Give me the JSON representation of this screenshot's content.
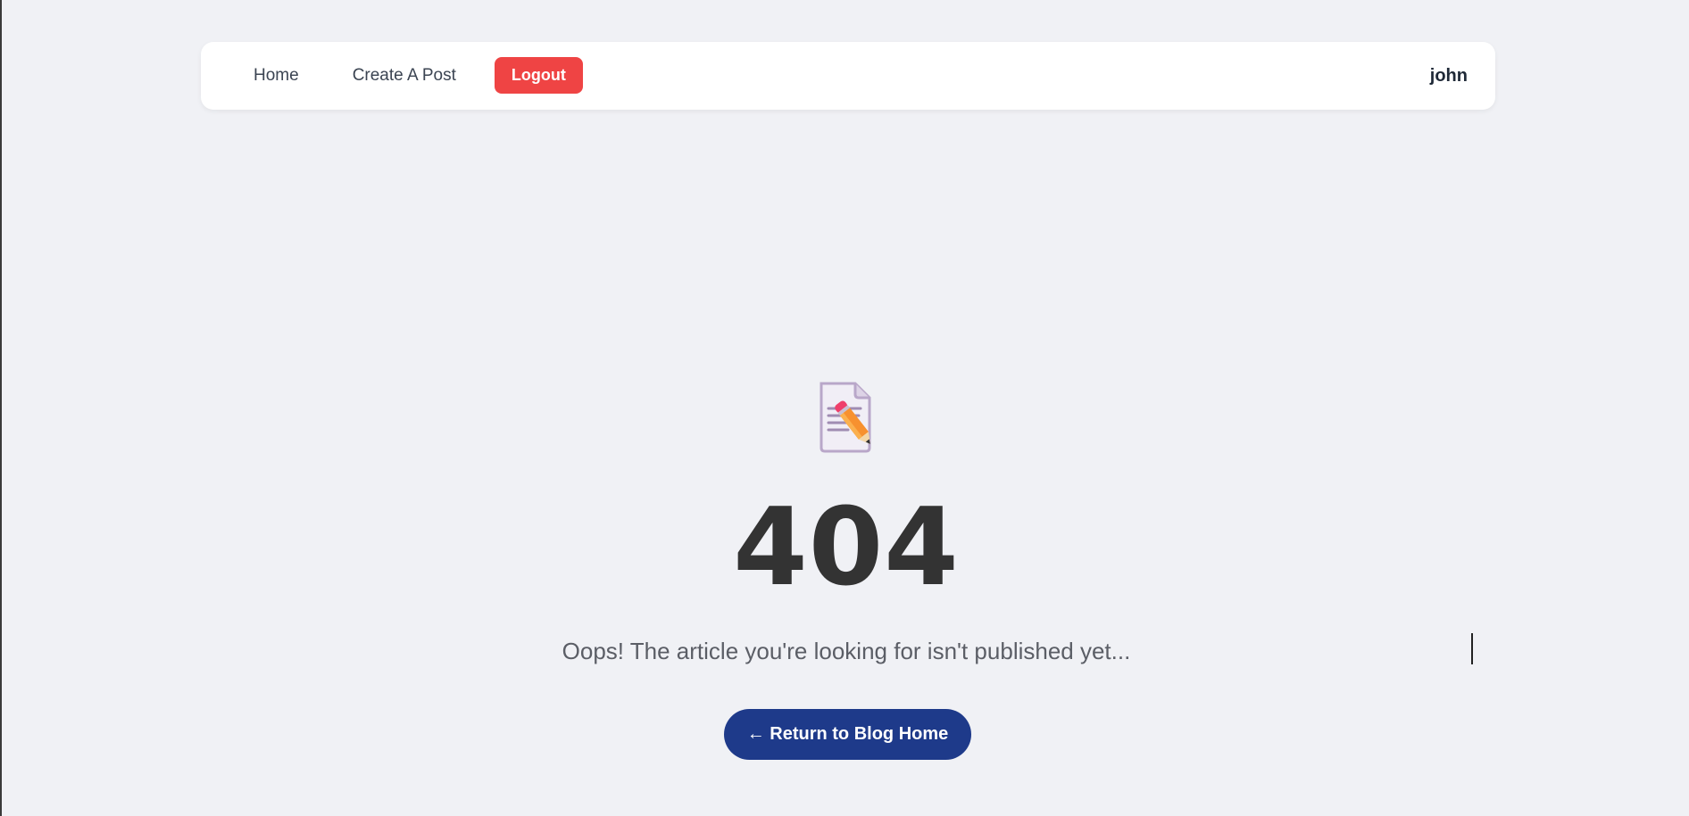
{
  "nav": {
    "home_label": "Home",
    "create_label": "Create A Post",
    "logout_label": "Logout",
    "username": "john"
  },
  "error": {
    "icon": "memo-pencil-icon",
    "code": "404",
    "message": "Oops! The article you're looking for isn't published yet...",
    "return_label": "← Return to Blog Home"
  },
  "colors": {
    "background": "#f0f1f5",
    "logout": "#ef4444",
    "return_button": "#1e3a8a",
    "code_text": "#333333"
  }
}
